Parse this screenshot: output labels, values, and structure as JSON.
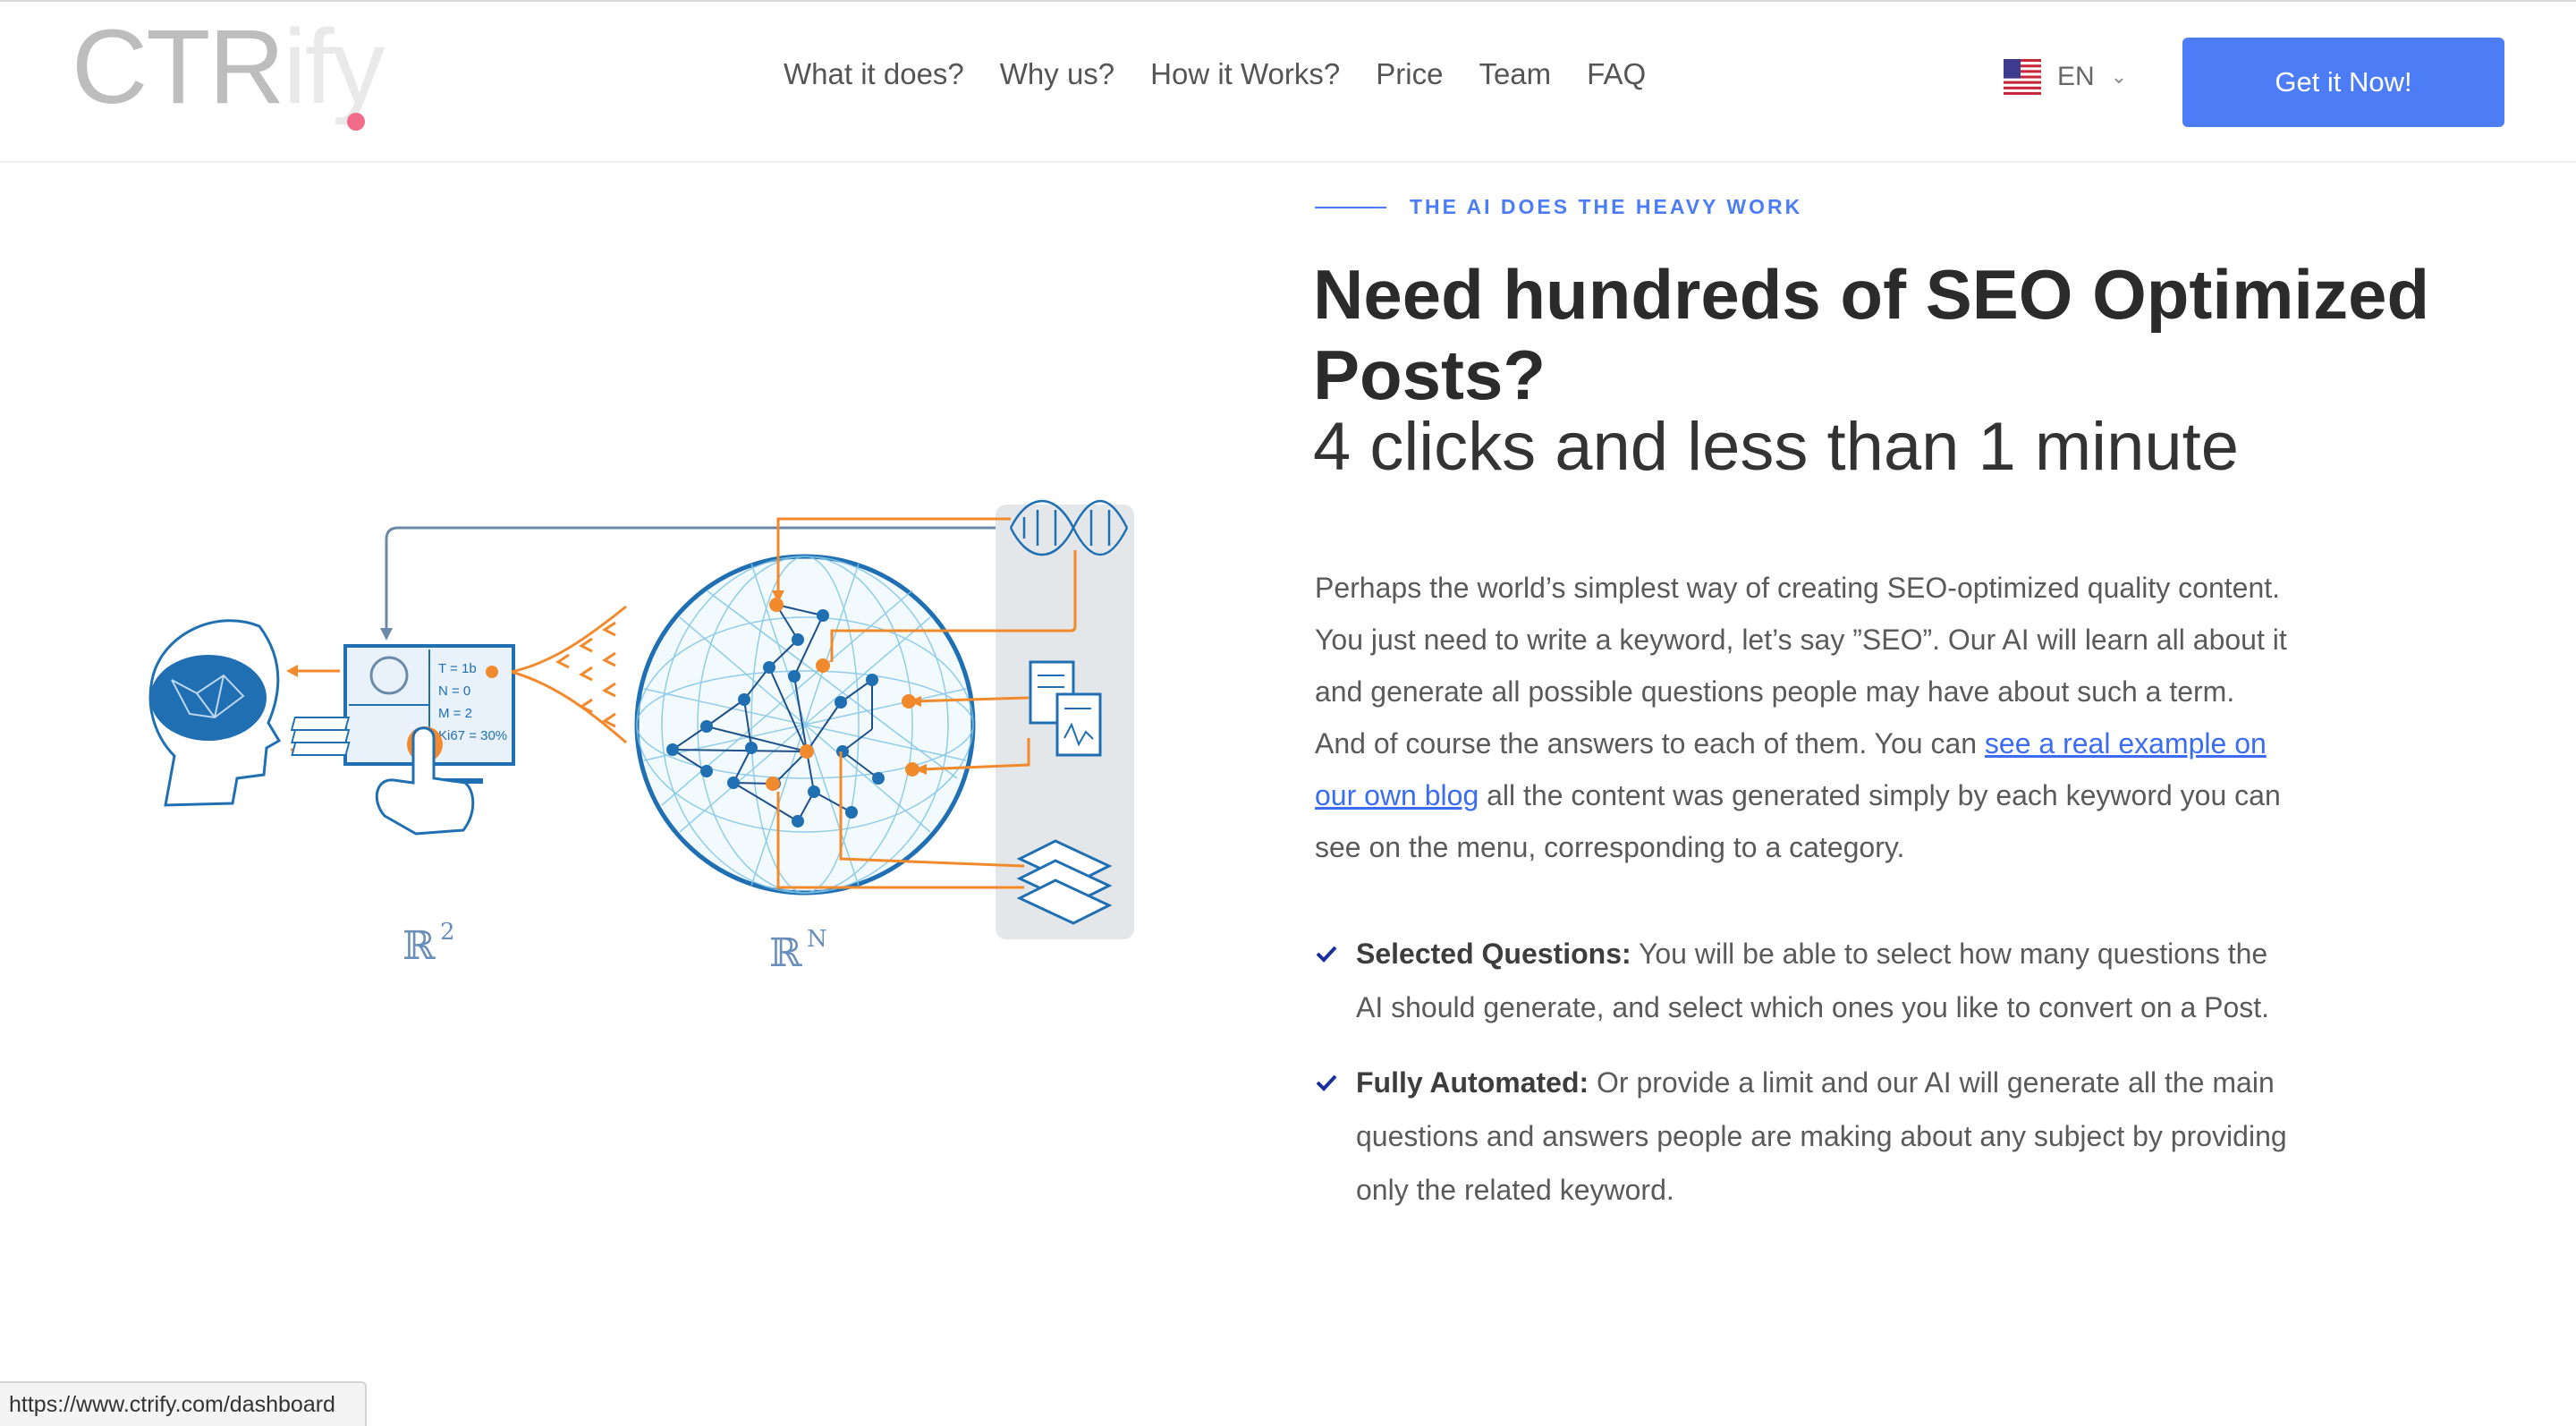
{
  "logo": {
    "part1": "CTR",
    "part2": "ify"
  },
  "nav": {
    "items": [
      {
        "label": "What it does?"
      },
      {
        "label": "Why us?"
      },
      {
        "label": "How it Works?"
      },
      {
        "label": "Price"
      },
      {
        "label": "Team"
      },
      {
        "label": "FAQ"
      }
    ]
  },
  "language": {
    "code": "EN",
    "flag_icon": "us-flag-icon"
  },
  "cta": {
    "label": "Get it Now!"
  },
  "illustration": {
    "label_left": "ℝ",
    "sup_left": "2",
    "label_right": "ℝ",
    "sup_right": "N"
  },
  "section": {
    "eyebrow": "THE AI DOES THE HEAVY WORK",
    "title": "Need hundreds of SEO Optimized Posts?",
    "subtitle": "4 clicks and less than 1 minute",
    "paragraph_before_link": "Perhaps the world’s simplest way of creating SEO-optimized quality content. You just need to write a keyword, let’s say ”SEO”. Our AI will learn all about it and generate all possible questions people may have about such a term. And of course the answers to each of them. You can ",
    "link_text": "see a real example on our own blog",
    "paragraph_after_link": " all the content was generated simply by each keyword you can see on the menu, corresponding to a category."
  },
  "features": [
    {
      "title": "Selected Questions:",
      "text": " You will be able to select how many questions the AI should generate, and select which ones you like to convert on a Post."
    },
    {
      "title": "Fully Automated:",
      "text": " Or provide a limit and our AI will generate all the main questions and answers people are making about any subject by providing only the related keyword."
    }
  ],
  "statusbar": {
    "url": "https://www.ctrify.com/dashboard"
  },
  "colors": {
    "accent": "#4d7df6",
    "illustration_blue": "#1f6fb2",
    "illustration_orange": "#f08a2c",
    "panel_gray": "#e3e7ea"
  }
}
